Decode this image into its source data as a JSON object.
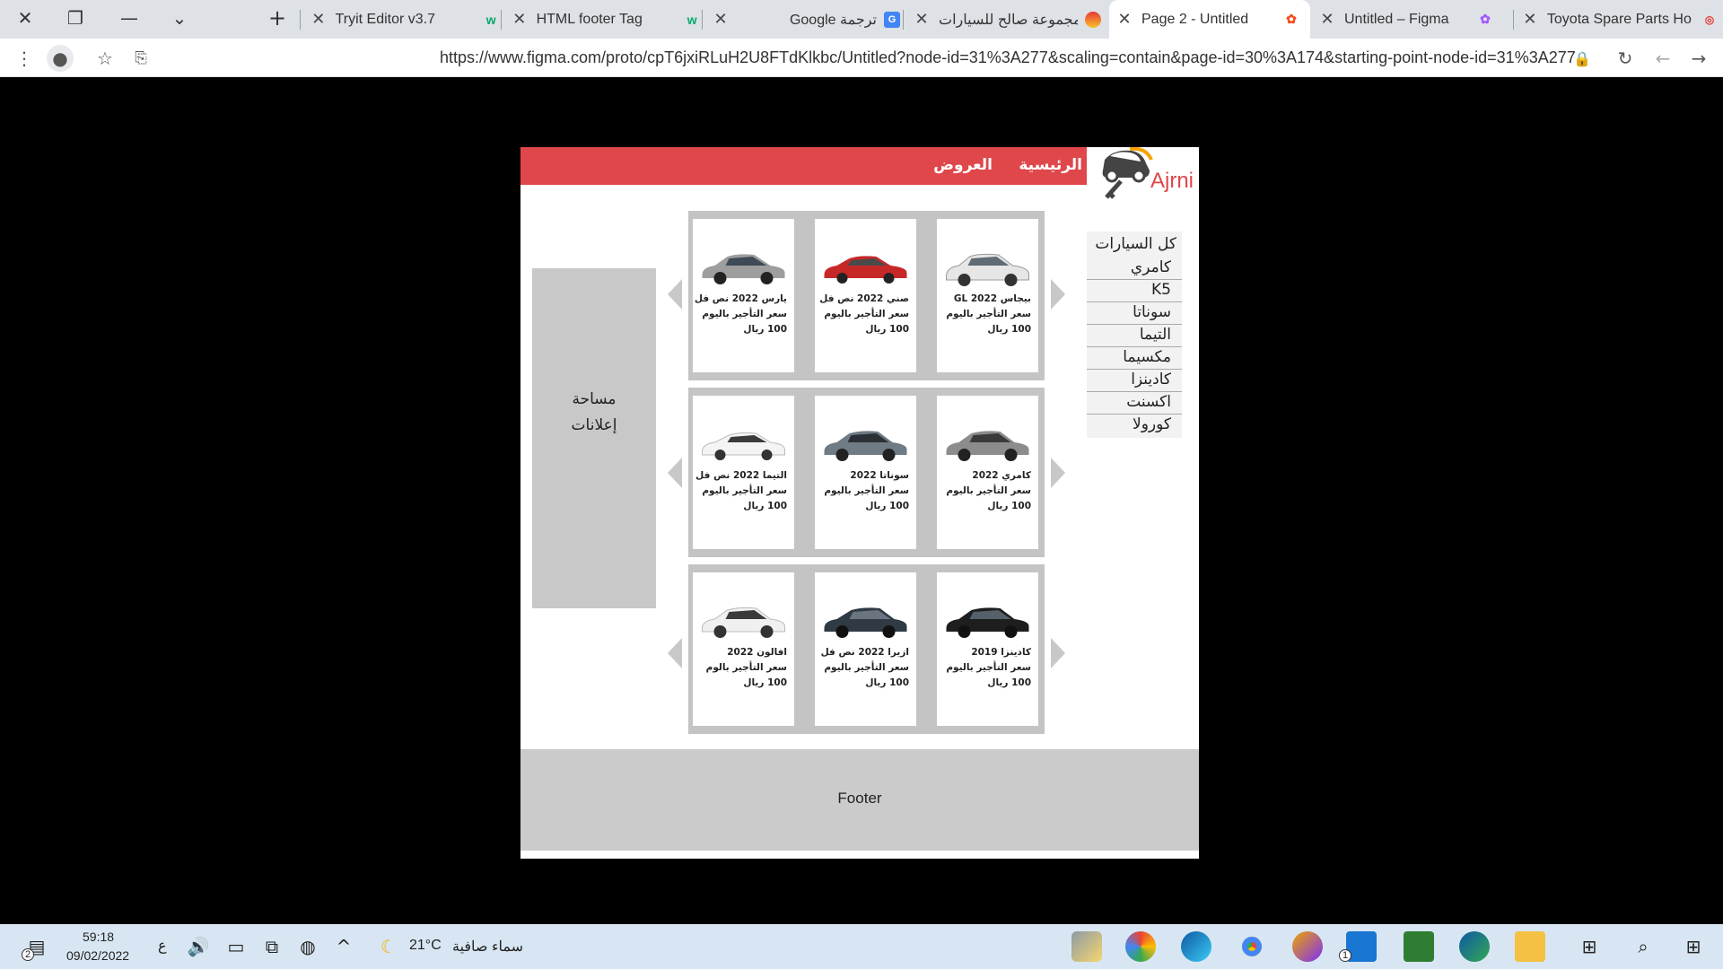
{
  "browser": {
    "tabs": [
      {
        "title": "Tryit Editor v3.7",
        "favicon": "w3schools-icon"
      },
      {
        "title": "HTML footer Tag",
        "favicon": "w3schools-icon"
      },
      {
        "title": "Google ترجمة",
        "favicon": "google-translate-icon"
      },
      {
        "title": "مجموعة صالح للسيارات",
        "favicon": "site-icon"
      },
      {
        "title": "Page 2 - Untitled",
        "favicon": "figma-icon",
        "active": true
      },
      {
        "title": "Untitled – Figma",
        "favicon": "figma-icon"
      },
      {
        "title": "Toyota Spare Parts Ho",
        "favicon": "site-icon"
      }
    ],
    "url": "https://www.figma.com/proto/cpT6jxiRLuH2U8FTdKlkbc/Untitled?node-id=31%3A277&scaling=contain&page-id=30%3A174&starting-point-node-id=31%3A277"
  },
  "site": {
    "logo": "Ajrni",
    "nav": {
      "home": "الرئيسية",
      "offers": "العروض"
    },
    "sidebar": {
      "title": "كل السيارات",
      "items": [
        "كامري",
        "K5",
        "سوناتا",
        "التيما",
        "مكسيما",
        "كادينزا",
        "اكسنت",
        "كورولا"
      ]
    },
    "ads": {
      "line1": "مساحة",
      "line2": "إعلانات"
    },
    "rows": [
      [
        {
          "name": "بيجاس GL 2022",
          "price_label": "سعر التأجير باليوم",
          "price": "100 ريال",
          "color": "#e6e6e6"
        },
        {
          "name": "صني 2022 نص فل",
          "price_label": "سعر التأجير باليوم",
          "price": "100 ريال",
          "color": "#c62828"
        },
        {
          "name": "يارس 2022 نص فل",
          "price_label": "سعر التأجير باليوم",
          "price": "100 ريال",
          "color": "#9e9e9e"
        }
      ],
      [
        {
          "name": "كامري 2022",
          "price_label": "سعر التأجير باليوم",
          "price": "100 ريال",
          "color": "#8c8c8c"
        },
        {
          "name": "سوناتا 2022",
          "price_label": "سعر التأجير باليوم",
          "price": "100 ريال",
          "color": "#6f7b85"
        },
        {
          "name": "التيما 2022 نص فل",
          "price_label": "سعر التأجير باليوم",
          "price": "100 ريال",
          "color": "#f4f4f4"
        }
      ],
      [
        {
          "name": "كادينزا 2019",
          "price_label": "سعر التأجير باليوم",
          "price": "100 ريال",
          "color": "#1e1e1e"
        },
        {
          "name": "ازيرا 2022 نص فل",
          "price_label": "سعر التأجير باليوم",
          "price": "100 ريال",
          "color": "#2f3a44"
        },
        {
          "name": "افالون 2022",
          "price_label": "سعر التأجير بالوم",
          "price": "100 ريال",
          "color": "#f0f0f0"
        }
      ]
    ],
    "footer": "Footer"
  },
  "taskbar": {
    "time": "59:18",
    "date": "09/02/2022",
    "lang": "ع",
    "weather_temp": "21°C",
    "weather_text": "سماء صافية",
    "notifications": "2",
    "mail_badge": "1"
  }
}
